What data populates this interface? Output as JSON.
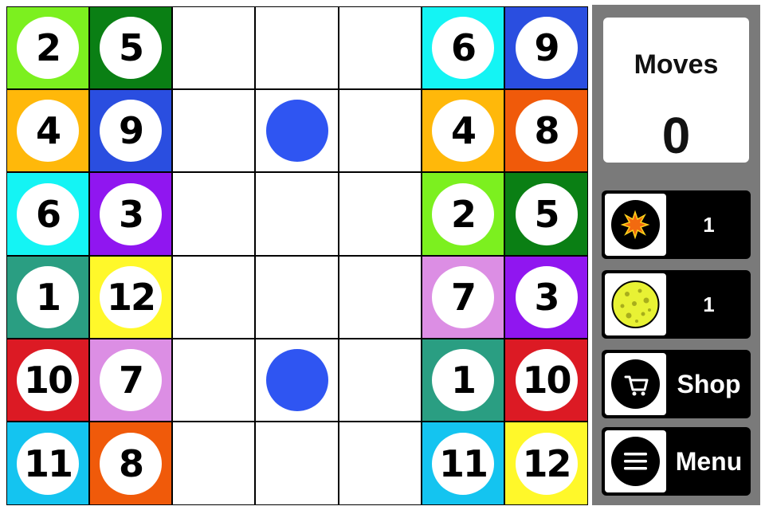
{
  "board": {
    "rows": [
      [
        {
          "n": "2",
          "c": "#7cf01f"
        },
        {
          "n": "5",
          "c": "#0a7f14"
        },
        null,
        null,
        null,
        {
          "n": "6",
          "c": "#14f4f4"
        },
        {
          "n": "9",
          "c": "#2a4ee0"
        }
      ],
      [
        {
          "n": "4",
          "c": "#ffb80a"
        },
        {
          "n": "9",
          "c": "#2a4ee0"
        },
        null,
        {
          "dot": true
        },
        null,
        {
          "n": "4",
          "c": "#ffb80a"
        },
        {
          "n": "8",
          "c": "#f05a0a"
        }
      ],
      [
        {
          "n": "6",
          "c": "#14f4f4"
        },
        {
          "n": "3",
          "c": "#9016f0"
        },
        null,
        null,
        null,
        {
          "n": "2",
          "c": "#7cf01f"
        },
        {
          "n": "5",
          "c": "#0a7f14"
        }
      ],
      [
        {
          "n": "1",
          "c": "#2a9e82"
        },
        {
          "n": "12",
          "c": "#fff82a"
        },
        null,
        null,
        null,
        {
          "n": "7",
          "c": "#dc8ee4"
        },
        {
          "n": "3",
          "c": "#9016f0"
        }
      ],
      [
        {
          "n": "10",
          "c": "#dc1a24"
        },
        {
          "n": "7",
          "c": "#dc8ee4"
        },
        null,
        {
          "dot": true
        },
        null,
        {
          "n": "1",
          "c": "#2a9e82"
        },
        {
          "n": "10",
          "c": "#dc1a24"
        }
      ],
      [
        {
          "n": "11",
          "c": "#14c4f0"
        },
        {
          "n": "8",
          "c": "#f05a0a"
        },
        null,
        null,
        null,
        {
          "n": "11",
          "c": "#14c4f0"
        },
        {
          "n": "12",
          "c": "#fff82a"
        }
      ]
    ],
    "dot_color": "#2f55f2"
  },
  "panel": {
    "moves_label": "Moves",
    "moves_value": "0",
    "powerups": [
      {
        "name": "bomb",
        "icon": "bomb-icon",
        "count": "1"
      },
      {
        "name": "moon",
        "icon": "moon-icon",
        "count": "1"
      }
    ],
    "shop_label": "Shop",
    "shop_icon": "cart-icon",
    "menu_label": "Menu",
    "menu_icon": "hamburger-menu-icon"
  }
}
